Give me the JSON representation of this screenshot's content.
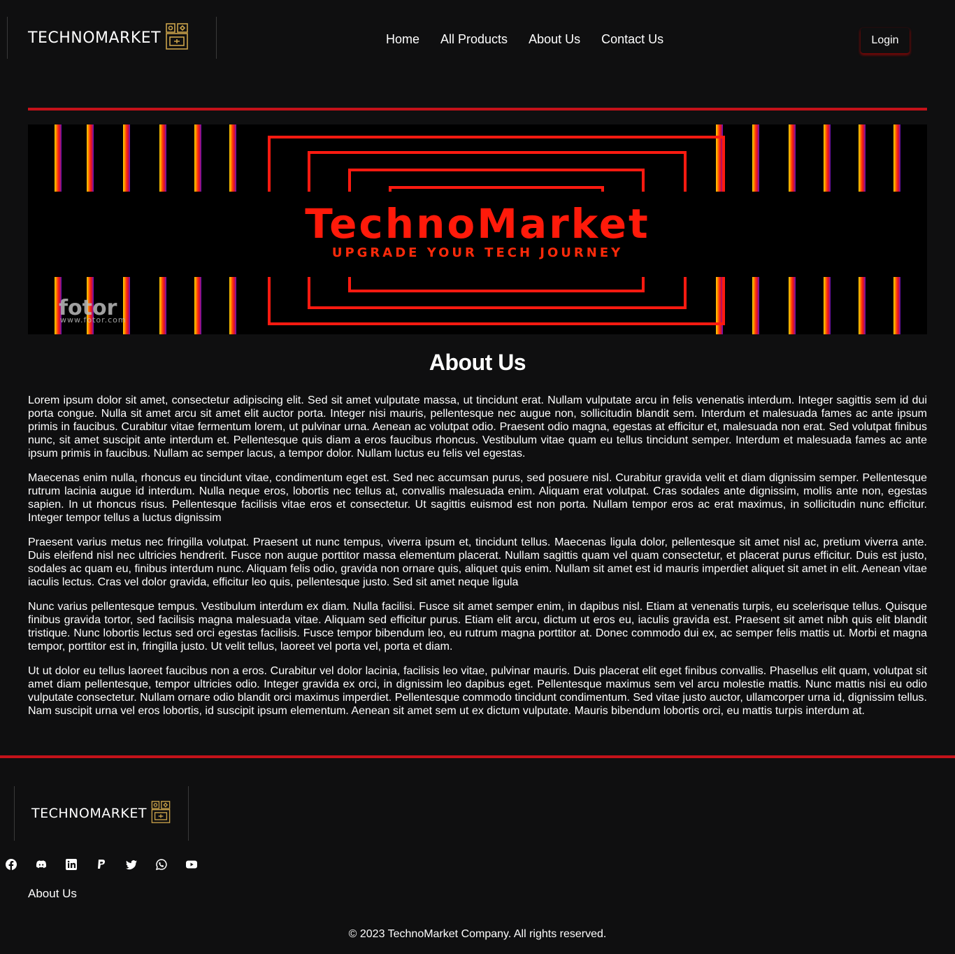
{
  "header": {
    "logo_text": "TECHNOMARKET",
    "nav": [
      "Home",
      "All Products",
      "About Us",
      "Contact Us"
    ],
    "login_label": "Login"
  },
  "banner": {
    "title": "TechnoMarket",
    "tagline": "UPGRADE YOUR TECH JOURNEY",
    "watermark": "fotor",
    "watermark_url": "www.fotor.com"
  },
  "main": {
    "title": "About Us",
    "paragraphs": [
      "Lorem ipsum dolor sit amet, consectetur adipiscing elit. Sed sit amet vulputate massa, ut tincidunt erat. Nullam vulputate arcu in felis venenatis interdum. Integer sagittis sem id dui porta congue. Nulla sit amet arcu sit amet elit auctor porta. Integer nisi mauris, pellentesque nec augue non, sollicitudin blandit sem. Interdum et malesuada fames ac ante ipsum primis in faucibus. Curabitur vitae fermentum lorem, ut pulvinar urna. Aenean ac volutpat odio. Praesent odio magna, egestas at efficitur et, malesuada non erat. Sed volutpat finibus nunc, sit amet suscipit ante interdum et. Pellentesque quis diam a eros faucibus rhoncus. Vestibulum vitae quam eu tellus tincidunt semper. Interdum et malesuada fames ac ante ipsum primis in faucibus. Nullam ac semper lacus, a tempor dolor. Nullam luctus eu felis vel egestas.",
      "Maecenas enim nulla, rhoncus eu tincidunt vitae, condimentum eget est. Sed nec accumsan purus, sed posuere nisl. Curabitur gravida velit et diam dignissim semper. Pellentesque rutrum lacinia augue id interdum. Nulla neque eros, lobortis nec tellus at, convallis malesuada enim. Aliquam erat volutpat. Cras sodales ante dignissim, mollis ante non, egestas sapien. In ut rhoncus risus. Pellentesque facilisis vitae eros et consectetur. Ut sagittis euismod est non porta. Nullam tempor eros ac erat maximus, in sollicitudin nunc efficitur. Integer tempor tellus a luctus dignissim",
      "Praesent varius metus nec fringilla volutpat. Praesent ut nunc tempus, viverra ipsum et, tincidunt tellus. Maecenas ligula dolor, pellentesque sit amet nisl ac, pretium viverra ante. Duis eleifend nisl nec ultricies hendrerit. Fusce non augue porttitor massa elementum placerat. Nullam sagittis quam vel quam consectetur, et placerat purus efficitur. Duis est justo, sodales ac quam eu, finibus interdum nunc. Aliquam felis odio, gravida non ornare quis, aliquet quis enim. Nullam sit amet est id mauris imperdiet aliquet sit amet in elit. Aenean vitae iaculis lectus. Cras vel dolor gravida, efficitur leo quis, pellentesque justo. Sed sit amet neque ligula",
      "Nunc varius pellentesque tempus. Vestibulum interdum ex diam. Nulla facilisi. Fusce sit amet semper enim, in dapibus nisl. Etiam at venenatis turpis, eu scelerisque tellus. Quisque finibus gravida tortor, sed facilisis magna malesuada vitae. Aliquam sed efficitur purus. Etiam elit arcu, dictum ut eros eu, iaculis gravida est. Praesent sit amet nibh quis elit blandit tristique. Nunc lobortis lectus sed orci egestas facilisis. Fusce tempor bibendum leo, eu rutrum magna porttitor at. Donec commodo dui ex, ac semper felis mattis ut. Morbi et magna tempor, porttitor est in, fringilla justo. Ut velit tellus, laoreet vel porta vel, porta et diam.",
      "Ut ut dolor eu tellus laoreet faucibus non a eros. Curabitur vel dolor lacinia, facilisis leo vitae, pulvinar mauris. Duis placerat elit eget finibus convallis. Phasellus elit quam, volutpat sit amet diam pellentesque, tempor ultricies odio. Integer gravida ex orci, in dignissim leo dapibus eget. Pellentesque maximus sem vel arcu molestie mattis. Nunc mattis nisi eu odio vulputate consectetur. Nullam ornare odio blandit orci maximus imperdiet. Pellentesque commodo tincidunt condimentum. Sed vitae justo auctor, ullamcorper urna id, dignissim tellus. Nam suscipit urna vel eros lobortis, id suscipit ipsum elementum. Aenean sit amet sem ut ex dictum vulputate. Mauris bibendum lobortis orci, eu mattis turpis interdum at."
    ]
  },
  "footer": {
    "logo_text": "TECHNOMARKET",
    "socials": [
      "facebook-icon",
      "discord-icon",
      "linkedin-icon",
      "paypal-icon",
      "twitter-icon",
      "whatsapp-icon",
      "youtube-icon"
    ],
    "about_link": "About Us",
    "copyright": "© 2023 TechnoMarket Company. All rights reserved."
  },
  "colors": {
    "background": "#0f0f10",
    "accent_red": "#c4121a",
    "banner_title": "#ff1a0a",
    "banner_tagline": "#ff2a0a",
    "logo_gold": "#c9a24a"
  }
}
